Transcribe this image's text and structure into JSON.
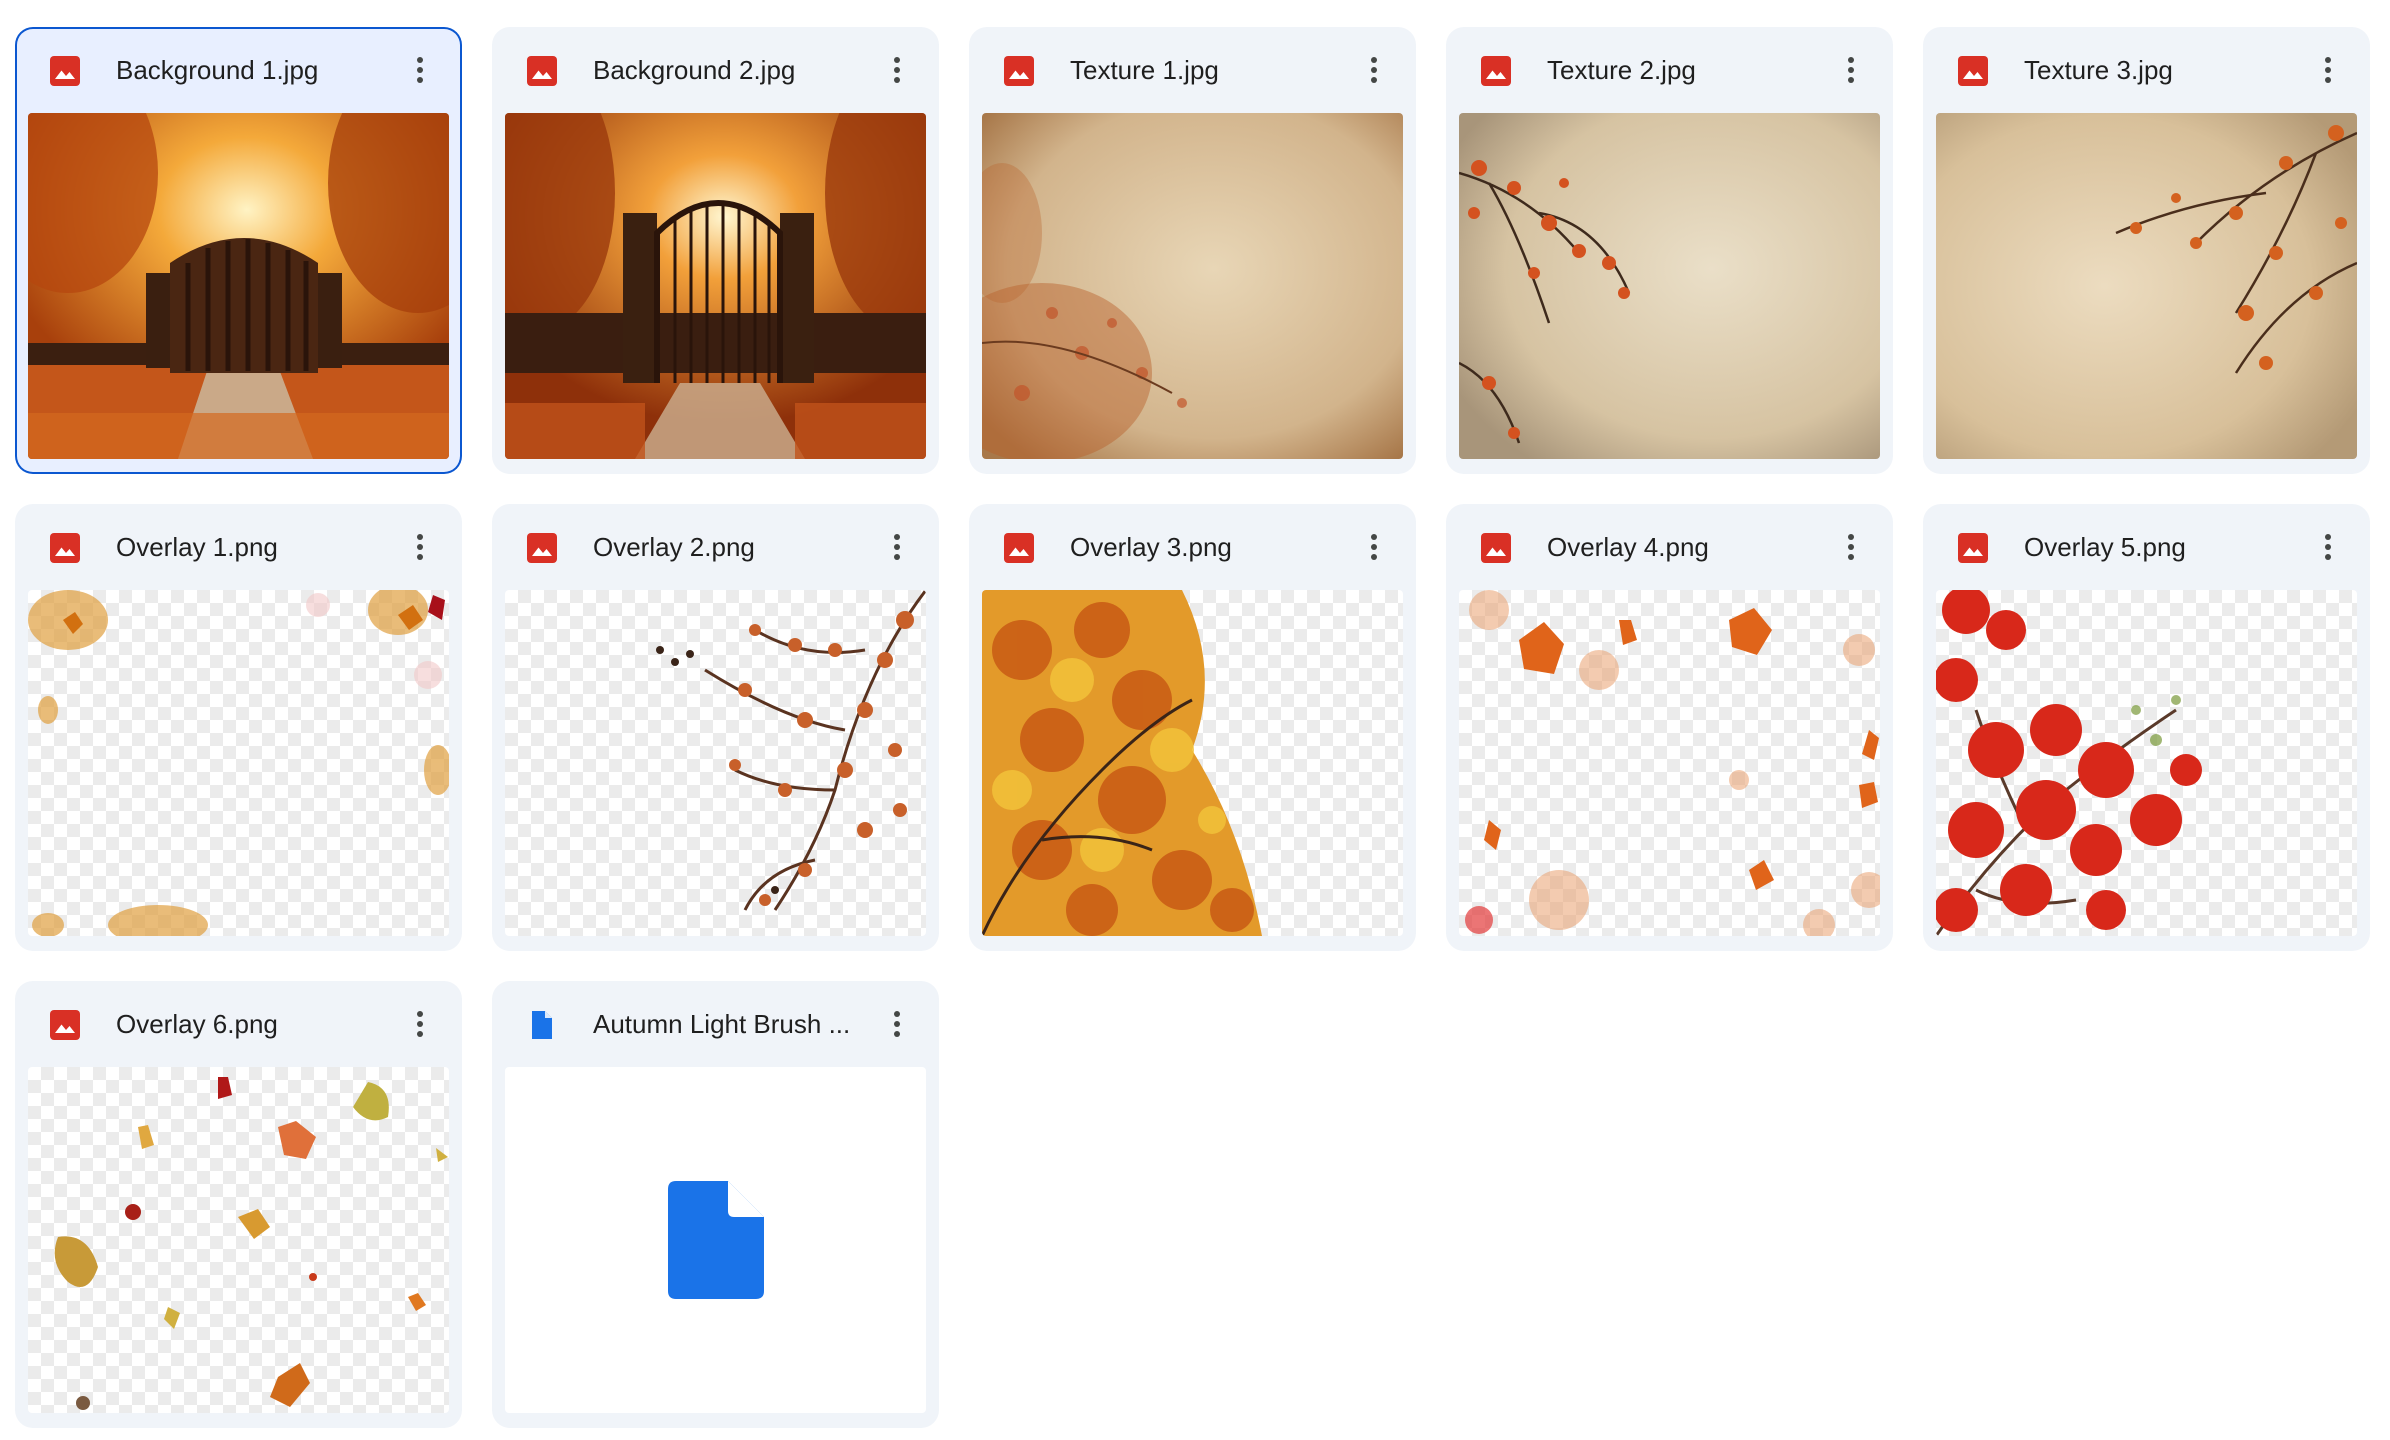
{
  "files": [
    {
      "name": "Background 1.jpg",
      "type": "image",
      "selected": true
    },
    {
      "name": "Background 2.jpg",
      "type": "image",
      "selected": false
    },
    {
      "name": "Texture 1.jpg",
      "type": "image",
      "selected": false
    },
    {
      "name": "Texture 2.jpg",
      "type": "image",
      "selected": false
    },
    {
      "name": "Texture 3.jpg",
      "type": "image",
      "selected": false
    },
    {
      "name": "Overlay 1.png",
      "type": "image",
      "selected": false
    },
    {
      "name": "Overlay 2.png",
      "type": "image",
      "selected": false
    },
    {
      "name": "Overlay 3.png",
      "type": "image",
      "selected": false
    },
    {
      "name": "Overlay 4.png",
      "type": "image",
      "selected": false
    },
    {
      "name": "Overlay 5.png",
      "type": "image",
      "selected": false
    },
    {
      "name": "Overlay 6.png",
      "type": "image",
      "selected": false
    },
    {
      "name": "Autumn Light Brush ...",
      "type": "document",
      "selected": false
    }
  ],
  "colors": {
    "image_icon": "#d93025",
    "doc_icon": "#1a73e8",
    "card_bg": "#f0f4f9",
    "selected_border": "#0b57d0"
  },
  "icons": {
    "image": "image-file-icon",
    "document": "document-file-icon",
    "more": "more-vert-icon"
  }
}
